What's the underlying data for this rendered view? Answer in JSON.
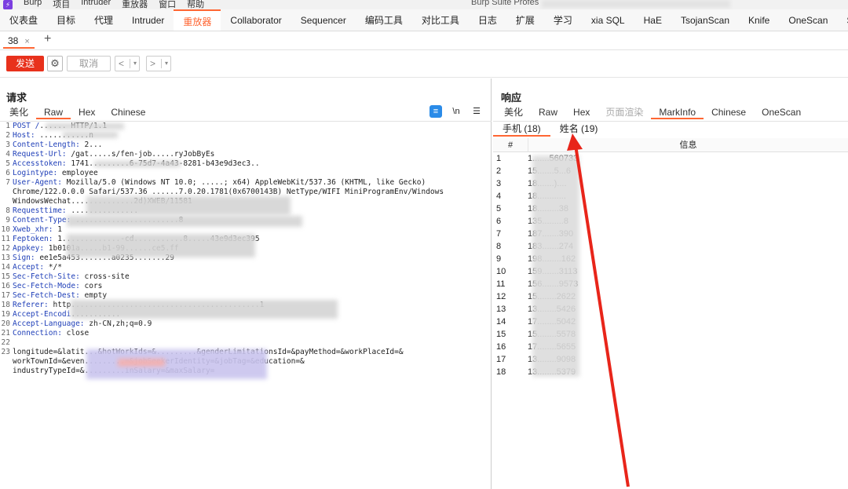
{
  "app": {
    "logo": "⚡",
    "menu": [
      "Burp",
      "项目",
      "Intruder",
      "重放器",
      "窗口",
      "帮助"
    ],
    "title": "Burp Suite Profes"
  },
  "main_tabs": [
    "仪表盘",
    "目标",
    "代理",
    "Intruder",
    "重放器",
    "Collaborator",
    "Sequencer",
    "编码工具",
    "对比工具",
    "日志",
    "扩展",
    "学习",
    "xia SQL",
    "HaE",
    "TsojanScan",
    "Knife",
    "OneScan",
    "ShiroScan"
  ],
  "active_main_tab": "重放器",
  "repeater_tab": {
    "label": "38",
    "close": "×",
    "add": "+"
  },
  "toolbar": {
    "send": "发送",
    "settings_icon": "gear-icon",
    "cancel": "取消",
    "back": "<",
    "forward": ">",
    "dropdown": "▾"
  },
  "request": {
    "title": "请求",
    "tabs": [
      "美化",
      "Raw",
      "Hex",
      "Chinese"
    ],
    "active_tab": "Raw",
    "icons": {
      "wrap": "≡",
      "newline": "\\n",
      "menu": "☰"
    },
    "lines": [
      {
        "n": "1",
        "key": "POST /",
        "val": "...... HTTP/1.1"
      },
      {
        "n": "2",
        "key": "Host:",
        "val": " ...........n"
      },
      {
        "n": "3",
        "key": "Content-Length:",
        "val": " 2..."
      },
      {
        "n": "4",
        "key": "Request-Url:",
        "val": " /gat.....s/fen-job.....ryJobByEs"
      },
      {
        "n": "5",
        "key": "Accesstoken:",
        "val": " 1741.........6-75d7-4a43-8281-b43e9d3ec3.."
      },
      {
        "n": "6",
        "key": "Logintype:",
        "val": " employee"
      },
      {
        "n": "7",
        "key": "User-Agent:",
        "val": " Mozilla/5.0 (Windows NT 10.0; .....; x64) AppleWebKit/537.36 (KHTML, like Gecko)"
      },
      {
        "n": "",
        "key": "",
        "val": "Chrome/122.0.0.0 Safari/537.36 ......7.0.20.1781(0x6700143B) NetType/WIFI MiniProgramEnv/Windows"
      },
      {
        "n": "",
        "key": "",
        "val": "WindowsWechat..............2d)XWEB/11581"
      },
      {
        "n": "8",
        "key": "Requesttime:",
        "val": " ..............."
      },
      {
        "n": "9",
        "key": "Content-Type:",
        "val": " .......................8"
      },
      {
        "n": "10",
        "key": "Xweb_xhr:",
        "val": " 1"
      },
      {
        "n": "11",
        "key": "Feptoken:",
        "val": " 1.............-cd...........8.....43e9d3ec395"
      },
      {
        "n": "12",
        "key": "Appkey:",
        "val": " 1b0101a.....b1-99......ce5.ff"
      },
      {
        "n": "13",
        "key": "Sign:",
        "val": " ee1e5a453.......a0235.......29"
      },
      {
        "n": "14",
        "key": "Accept:",
        "val": " */*"
      },
      {
        "n": "15",
        "key": "Sec-Fetch-Site:",
        "val": " cross-site"
      },
      {
        "n": "16",
        "key": "Sec-Fetch-Mode:",
        "val": " cors"
      },
      {
        "n": "17",
        "key": "Sec-Fetch-Dest:",
        "val": " empty"
      },
      {
        "n": "18",
        "key": "Referer:",
        "val": " http..........................................1"
      },
      {
        "n": "19",
        "key": "Accept-Encodi",
        "val": "..........."
      },
      {
        "n": "20",
        "key": "Accept-Language:",
        "val": " zh-CN,zh;q=0.9"
      },
      {
        "n": "21",
        "key": "Connection:",
        "val": " close"
      },
      {
        "n": "22",
        "key": "",
        "val": ""
      },
      {
        "n": "23",
        "key": "",
        "val": "longitude=&latit...&hotWorkIds=&.........&genderLimitationsId=&payMethod=&workPlaceId=&"
      },
      {
        "n": "",
        "key": "",
        "val": "workTownId=&even.........=&jobSeekerIdentity=&jobTag=&education=&"
      },
      {
        "n": "",
        "key": "",
        "val": "industryTypeId=&.........inSalary=&maxSalary="
      }
    ]
  },
  "response": {
    "title": "响应",
    "tabs": [
      "美化",
      "Raw",
      "Hex",
      "页面渲染",
      "MarkInfo",
      "Chinese",
      "OneScan"
    ],
    "active_tab": "MarkInfo",
    "sub_tabs": [
      "手机 (18)",
      "姓名 (19)"
    ],
    "active_sub_tab": "手机 (18)",
    "columns": [
      "#",
      "信息"
    ],
    "rows": [
      {
        "n": "1",
        "v": "1.......560733"
      },
      {
        "n": "2",
        "v": "15.......5...6"
      },
      {
        "n": "3",
        "v": "18.......)...."
      },
      {
        "n": "4",
        "v": "18............"
      },
      {
        "n": "5",
        "v": "18.........38"
      },
      {
        "n": "6",
        "v": "135.........8"
      },
      {
        "n": "7",
        "v": "187.......390"
      },
      {
        "n": "8",
        "v": "183.......274"
      },
      {
        "n": "9",
        "v": "198........162"
      },
      {
        "n": "10",
        "v": "159.......3113"
      },
      {
        "n": "11",
        "v": "156.......9573"
      },
      {
        "n": "12",
        "v": "15........2622"
      },
      {
        "n": "13",
        "v": "13........5426"
      },
      {
        "n": "14",
        "v": "17........5042"
      },
      {
        "n": "15",
        "v": "15........5578"
      },
      {
        "n": "16",
        "v": "17........5655"
      },
      {
        "n": "17",
        "v": "13........9098"
      },
      {
        "n": "18",
        "v": "13........5379"
      }
    ]
  },
  "annotation_color": "#e8251a"
}
